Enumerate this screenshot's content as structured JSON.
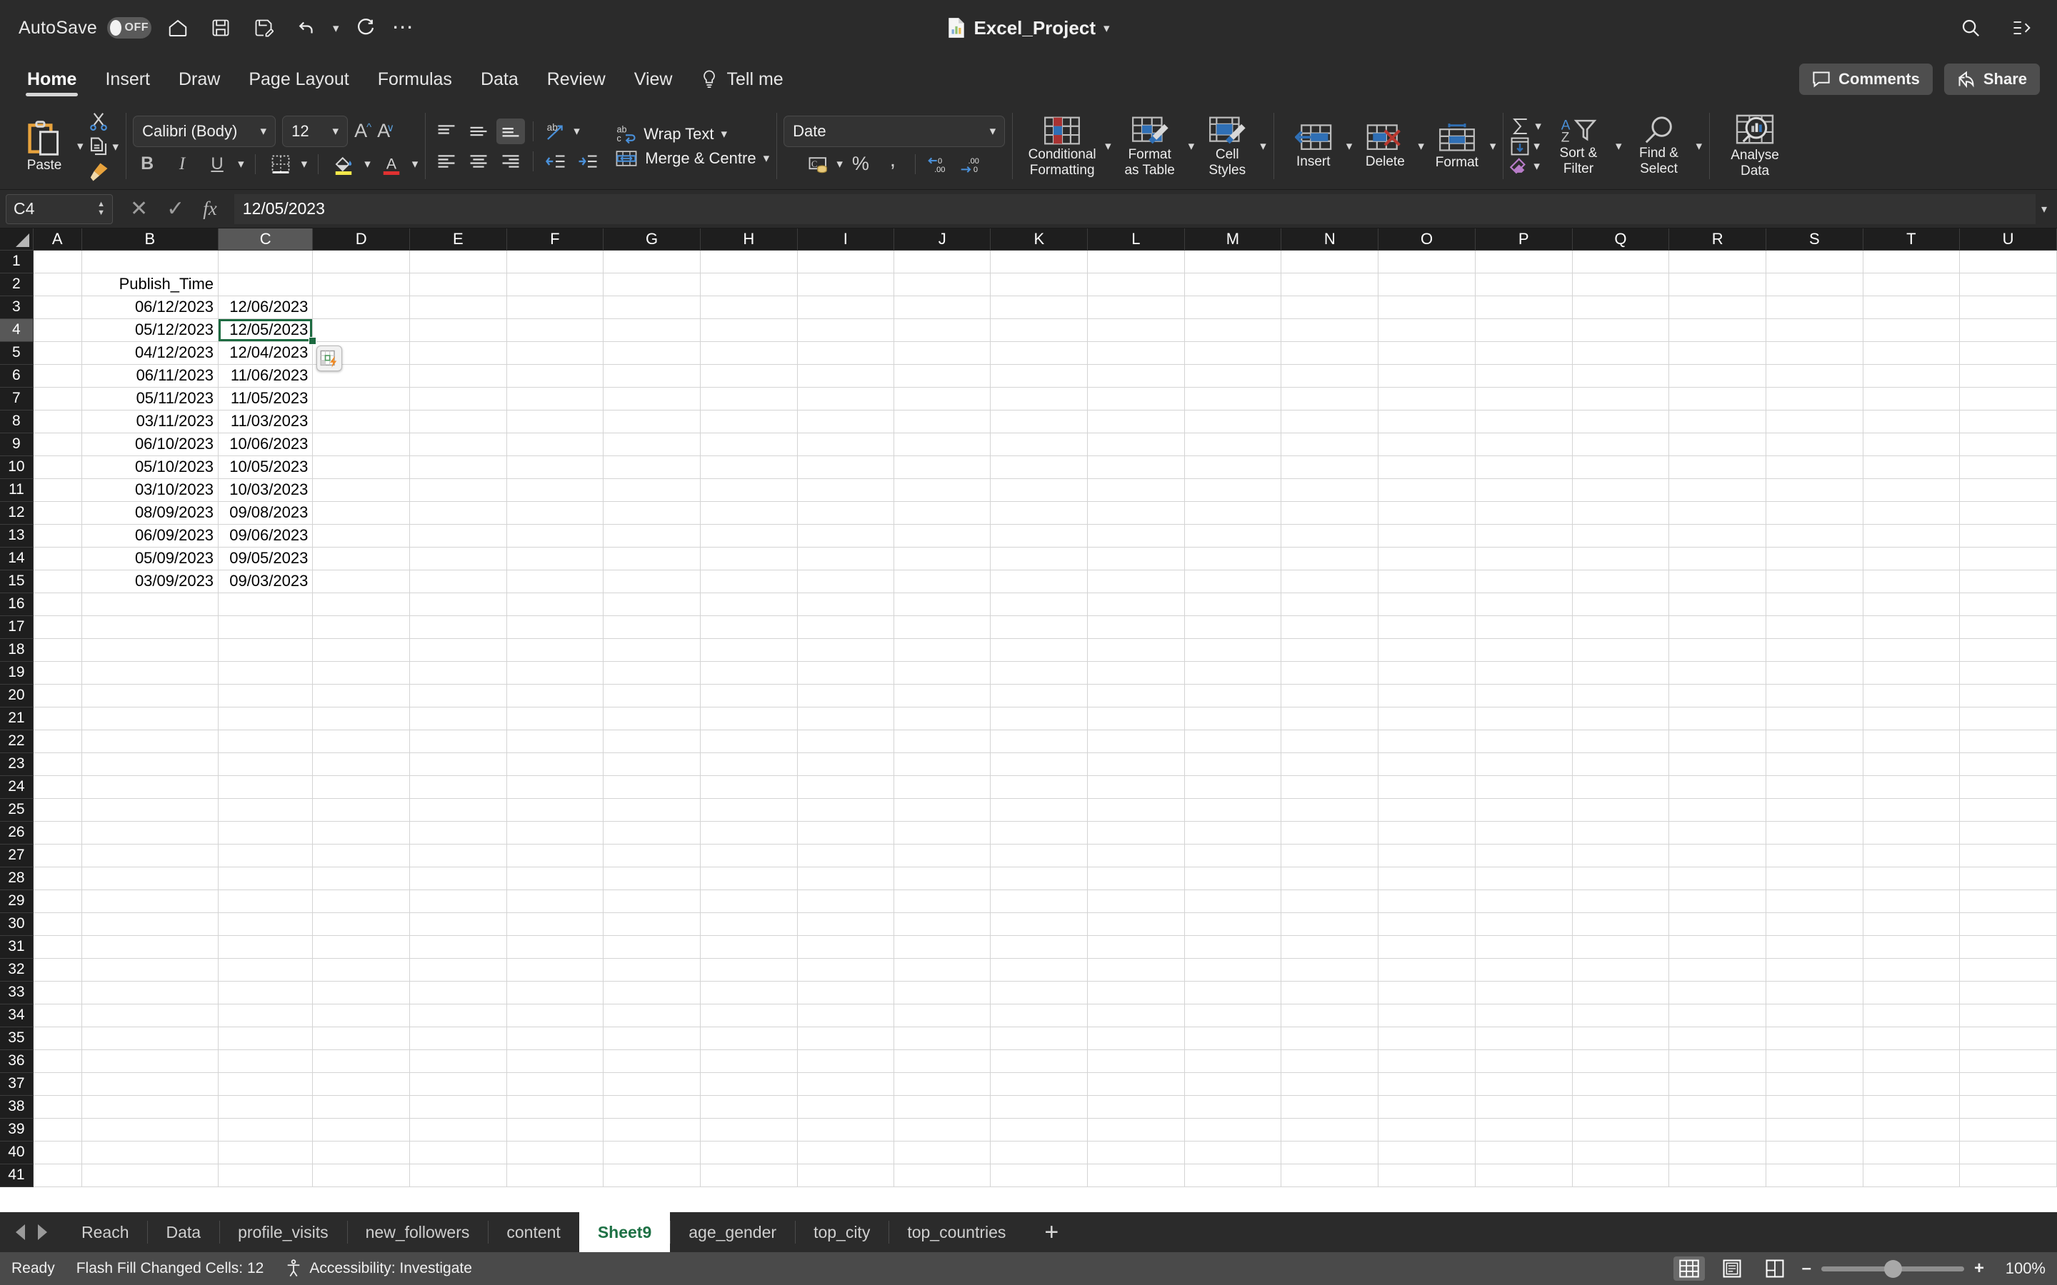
{
  "titlebar": {
    "autosave_label": "AutoSave",
    "autosave_state": "OFF",
    "doc_title": "Excel_Project",
    "icons": [
      "home-icon",
      "save-icon",
      "save-as-icon",
      "undo-icon",
      "redo-icon",
      "more-options-icon",
      "search-icon",
      "ribbon-display-icon"
    ]
  },
  "ribbon_tabs": {
    "items": [
      {
        "label": "Home",
        "active": true
      },
      {
        "label": "Insert",
        "active": false
      },
      {
        "label": "Draw",
        "active": false
      },
      {
        "label": "Page Layout",
        "active": false
      },
      {
        "label": "Formulas",
        "active": false
      },
      {
        "label": "Data",
        "active": false
      },
      {
        "label": "Review",
        "active": false
      },
      {
        "label": "View",
        "active": false
      },
      {
        "label": "Tell me",
        "active": false
      }
    ],
    "comments_label": "Comments",
    "share_label": "Share"
  },
  "ribbon": {
    "clipboard": {
      "paste_label": "Paste"
    },
    "font": {
      "family": "Calibri (Body)",
      "size": "12"
    },
    "alignment": {
      "wrap_text": "Wrap Text",
      "merge_centre": "Merge & Centre"
    },
    "number": {
      "format": "Date"
    },
    "styles": {
      "conditional_formatting": "Conditional\nFormatting",
      "conditional_formatting_l1": "Conditional",
      "conditional_formatting_l2": "Formatting",
      "format_as_table_l1": "Format",
      "format_as_table_l2": "as Table",
      "cell_styles_l1": "Cell",
      "cell_styles_l2": "Styles"
    },
    "cells": {
      "insert": "Insert",
      "delete": "Delete",
      "format": "Format"
    },
    "editing": {
      "sort_filter_l1": "Sort &",
      "sort_filter_l2": "Filter",
      "find_select_l1": "Find &",
      "find_select_l2": "Select"
    },
    "analysis": {
      "analyse_data_l1": "Analyse",
      "analyse_data_l2": "Data"
    }
  },
  "formula_bar": {
    "name_box": "C4",
    "value": "12/05/2023"
  },
  "grid": {
    "columns": [
      "A",
      "B",
      "C",
      "D",
      "E",
      "F",
      "G",
      "H",
      "I",
      "J",
      "K",
      "L",
      "M",
      "N",
      "O",
      "P",
      "Q",
      "R",
      "S",
      "T",
      "U"
    ],
    "selected_column": "C",
    "selected_row": 4,
    "selected_cell": "C4",
    "row_count": 41,
    "cells": {
      "B2": "Publish_Time",
      "B3": "06/12/2023",
      "C3": "12/06/2023",
      "B4": "05/12/2023",
      "C4": "12/05/2023",
      "B5": "04/12/2023",
      "C5": "12/04/2023",
      "B6": "06/11/2023",
      "C6": "11/06/2023",
      "B7": "05/11/2023",
      "C7": "11/05/2023",
      "B8": "03/11/2023",
      "C8": "11/03/2023",
      "B9": "06/10/2023",
      "C9": "10/06/2023",
      "B10": "05/10/2023",
      "C10": "10/05/2023",
      "B11": "03/10/2023",
      "C11": "10/03/2023",
      "B12": "08/09/2023",
      "C12": "09/08/2023",
      "B13": "06/09/2023",
      "C13": "09/06/2023",
      "B14": "05/09/2023",
      "C14": "09/05/2023",
      "B15": "03/09/2023",
      "C15": "09/03/2023"
    },
    "smart_tag": "flash-fill-options-icon"
  },
  "sheet_tabs": {
    "items": [
      {
        "label": "Reach",
        "active": false
      },
      {
        "label": "Data",
        "active": false
      },
      {
        "label": "profile_visits",
        "active": false
      },
      {
        "label": "new_followers",
        "active": false
      },
      {
        "label": "content",
        "active": false
      },
      {
        "label": "Sheet9",
        "active": true
      },
      {
        "label": "age_gender",
        "active": false
      },
      {
        "label": "top_city",
        "active": false
      },
      {
        "label": "top_countries",
        "active": false
      }
    ],
    "add_label": "+"
  },
  "status_bar": {
    "ready": "Ready",
    "flash_fill": "Flash Fill Changed Cells: 12",
    "accessibility": "Accessibility: Investigate",
    "zoom": "100%",
    "zoom_out": "–",
    "zoom_in": "+"
  },
  "colors": {
    "accent_green": "#1e7145",
    "selection_border": "#1d6b41",
    "ribbon_bg": "#2b2b2b",
    "status_bg": "#4a4a4a",
    "blue_icon": "#4a90d9",
    "orange_icon": "#e8a33d"
  }
}
